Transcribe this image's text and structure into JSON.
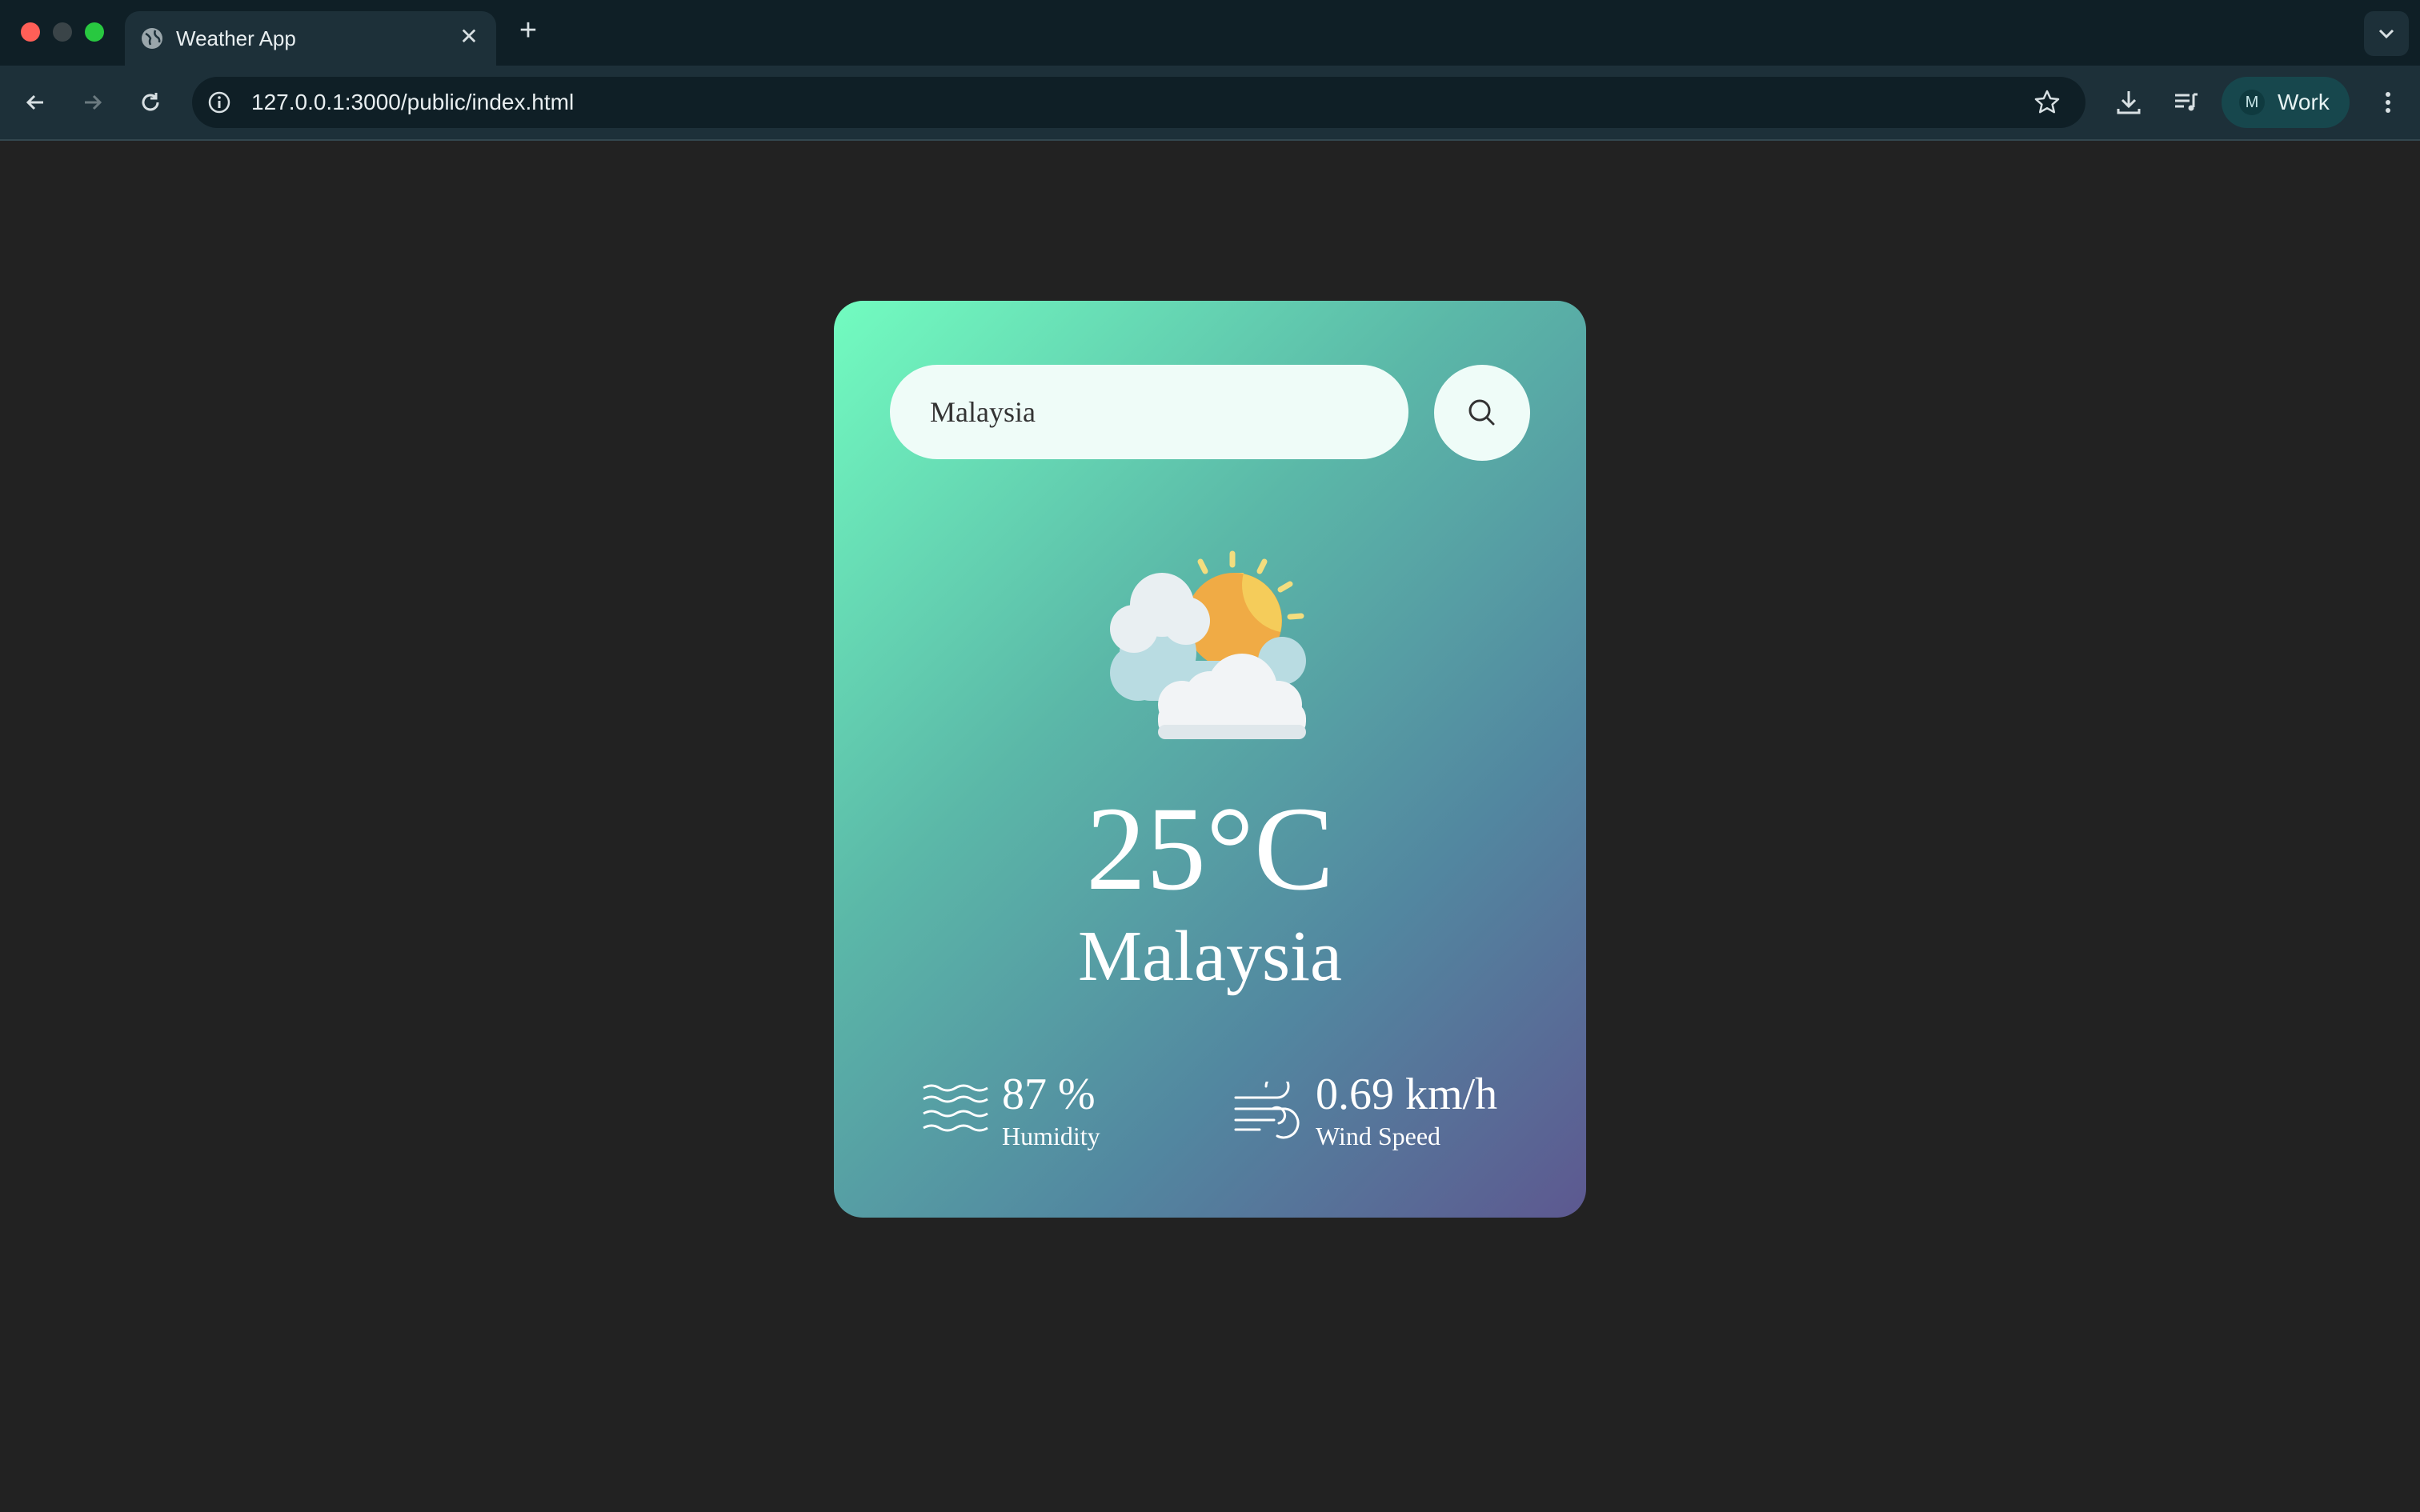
{
  "browser": {
    "tab_title": "Weather App",
    "url": "127.0.0.1:3000/public/index.html",
    "profile_initial": "M",
    "profile_label": "Work"
  },
  "weather": {
    "search_value": "Malaysia",
    "temperature": "25°C",
    "city": "Malaysia",
    "humidity_value": "87 %",
    "humidity_label": "Humidity",
    "wind_value": "0.69 km/h",
    "wind_label": "Wind Speed"
  }
}
